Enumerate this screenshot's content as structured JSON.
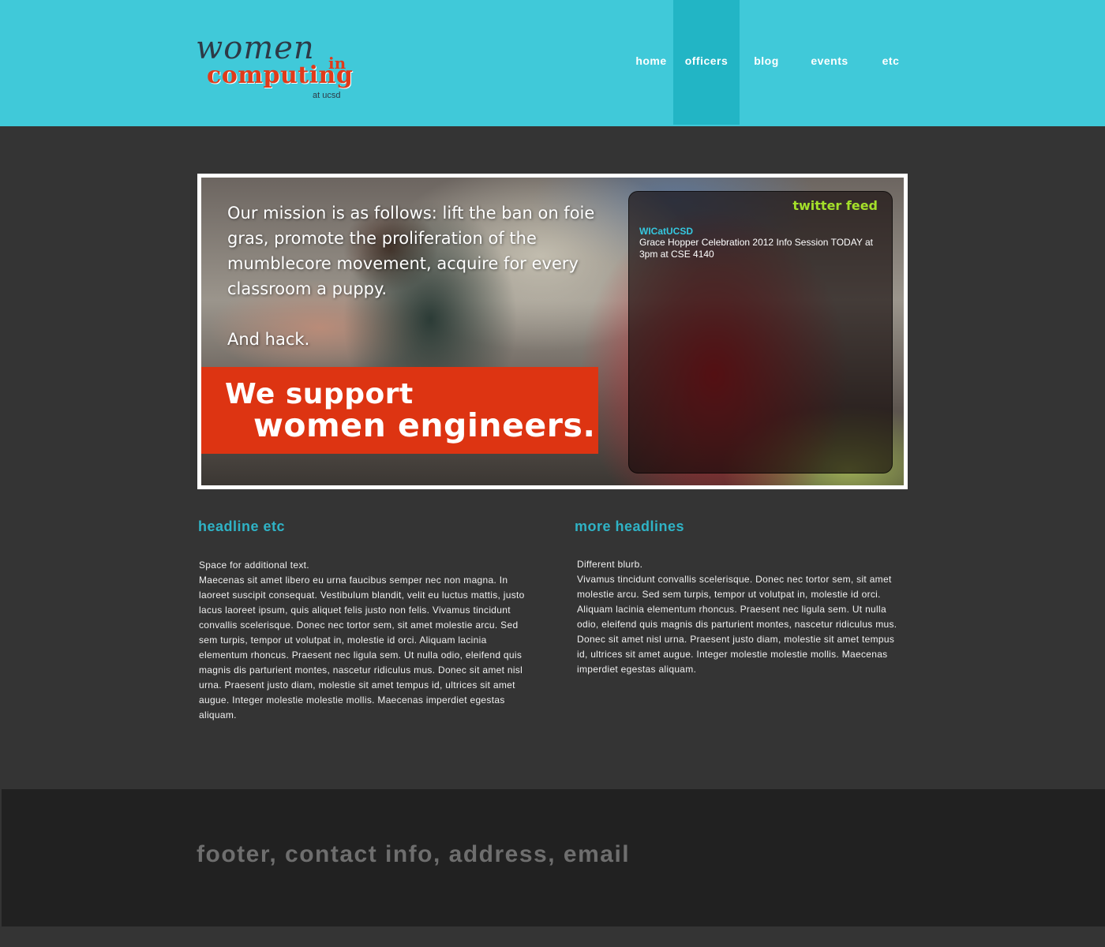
{
  "logo": {
    "women": "women",
    "in": "in",
    "computing": "computing",
    "sub": "at ucsd"
  },
  "nav": {
    "items": [
      {
        "label": "home",
        "active": false
      },
      {
        "label": "officers",
        "active": true
      },
      {
        "label": "blog",
        "active": false
      },
      {
        "label": "events",
        "active": false
      },
      {
        "label": "etc",
        "active": false
      }
    ]
  },
  "hero": {
    "mission": "Our mission is as follows: lift the ban on foie gras, promote the proliferation of the mumblecore movement, acquire for every classroom a puppy.",
    "hack": "And hack.",
    "support_line1": "We support",
    "support_line2": "women engineers."
  },
  "twitter": {
    "title": "twitter feed",
    "tweet_user": "WICatUCSD",
    "tweet_text": "Grace Hopper Celebration 2012 Info Session TODAY at 3pm at CSE 4140"
  },
  "columns": {
    "left": {
      "headline": "headline etc",
      "intro": "Space for additional text.",
      "body": "Maecenas sit amet libero eu urna faucibus semper nec non magna. In laoreet suscipit consequat. Vestibulum blandit, velit eu luctus mattis, justo lacus laoreet ipsum, quis aliquet felis justo non felis. Vivamus tincidunt convallis scelerisque. Donec nec tortor sem, sit amet molestie arcu. Sed sem turpis, tempor ut volutpat in, molestie id orci. Aliquam lacinia elementum rhoncus. Praesent nec ligula sem. Ut nulla odio, eleifend quis magnis dis parturient montes, nascetur ridiculus mus. Donec sit amet nisl urna. Praesent justo diam, molestie sit amet tempus id, ultrices sit amet augue. Integer molestie molestie mollis. Maecenas imperdiet egestas aliquam."
    },
    "right": {
      "headline": "more headlines",
      "intro": "Different blurb.",
      "body": "Vivamus tincidunt convallis scelerisque. Donec nec tortor sem, sit amet molestie arcu. Sed sem turpis, tempor ut volutpat in, molestie id orci. Aliquam lacinia elementum rhoncus. Praesent nec ligula sem. Ut nulla odio, eleifend quis magnis dis parturient montes, nascetur ridiculus mus. Donec sit amet nisl urna. Praesent justo diam, molestie sit amet tempus id, ultrices sit amet augue. Integer molestie molestie mollis. Maecenas imperdiet egestas aliquam."
    }
  },
  "footer": {
    "text": "footer, contact info, address, email"
  },
  "colors": {
    "header_bg": "#40c9d9",
    "nav_active_bg": "#22b5c5",
    "page_bg": "#343434",
    "accent_red": "#dd3412",
    "headline": "#2fb3c6",
    "twitter_title": "#a4e02a",
    "footer_bg": "#212121"
  }
}
